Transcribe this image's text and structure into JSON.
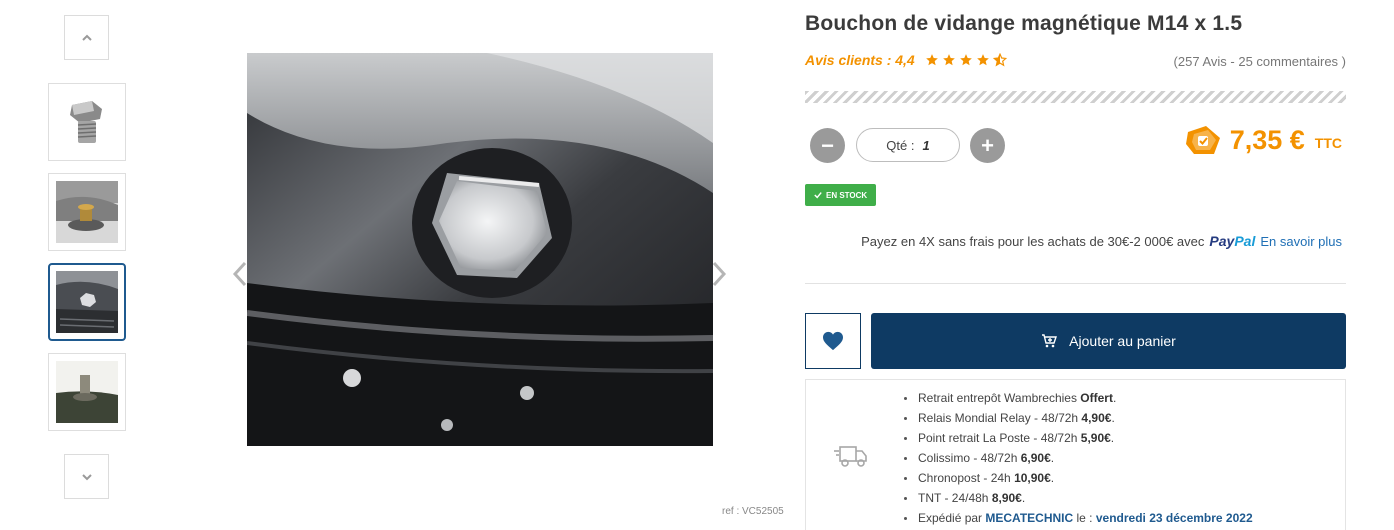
{
  "gallery": {
    "thumbnails": [
      {
        "label": "thumbnail-1"
      },
      {
        "label": "thumbnail-2"
      },
      {
        "label": "thumbnail-3"
      },
      {
        "label": "thumbnail-4"
      }
    ],
    "active_index": 2,
    "icons": {
      "up": "chevron-up-icon",
      "down": "chevron-down-icon",
      "prev": "chevron-left-icon",
      "next": "chevron-right-icon"
    },
    "ref": "ref : VC52505"
  },
  "product": {
    "title": "Bouchon de vidange magnétique M14 x 1.5",
    "rating_label": "Avis clients : 4,4",
    "rating_value": 4.4,
    "rating_max": 5,
    "review_count": "(257 Avis - 25 commentaires )"
  },
  "quantity": {
    "label": "Qté :",
    "value": "1",
    "minus": "−",
    "plus": "+"
  },
  "price": {
    "amount": "7,35 €",
    "suffix": "TTC",
    "icon": "price-tag-icon"
  },
  "stock": {
    "label": "EN STOCK",
    "icon": "check-icon",
    "color": "#3fae49"
  },
  "paypal": {
    "text": "Payez en 4X sans frais pour les achats de 30€-2 000€ avec",
    "logo_part1": "Pay",
    "logo_part2": "Pal",
    "link": "En savoir plus"
  },
  "actions": {
    "wishlist_icon": "heart-icon",
    "cart_icon": "cart-add-icon",
    "add_to_cart": "Ajouter au panier"
  },
  "shipping": {
    "icon": "truck-icon",
    "items": [
      {
        "text": "Retrait entrepôt Wambrechies ",
        "bold": "Offert",
        "tail": "."
      },
      {
        "text": "Relais Mondial Relay - 48/72h ",
        "bold": "4,90€",
        "tail": "."
      },
      {
        "text": "Point retrait La Poste - 48/72h ",
        "bold": "5,90€",
        "tail": "."
      },
      {
        "text": "Colissimo - 48/72h ",
        "bold": "6,90€",
        "tail": "."
      },
      {
        "text": "Chronopost - 24h ",
        "bold": "10,90€",
        "tail": "."
      },
      {
        "text": "TNT - 24/48h ",
        "bold": "8,90€",
        "tail": "."
      }
    ],
    "expedition": {
      "prefix": "Expédié par ",
      "seller": "MECATECHNIC",
      "middle": " le : ",
      "date": "vendredi 23 décembre 2022"
    }
  },
  "colors": {
    "accent_orange": "#f39200",
    "navy": "#0e3a63",
    "link_blue": "#1f6fb5"
  }
}
